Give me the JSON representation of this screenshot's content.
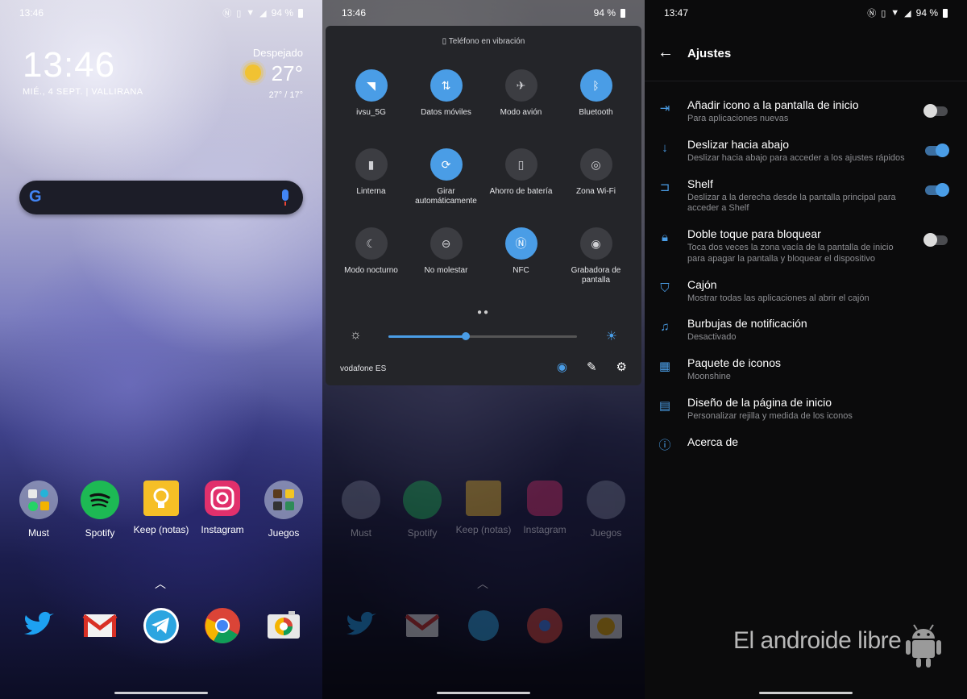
{
  "colors": {
    "accent": "#4a9de6",
    "panel": "#242529",
    "settings_bg": "#0b0b0c"
  },
  "home": {
    "status": {
      "time": "13:46",
      "battery": "94 %"
    },
    "clock": {
      "time": "13:46",
      "date": "MIÉ., 4 SEPT. | VALLIRANA"
    },
    "weather": {
      "condition": "Despejado",
      "temp": "27°",
      "range": "27° / 17°"
    },
    "apps": [
      {
        "label": "Must",
        "icon": "folder-icon"
      },
      {
        "label": "Spotify",
        "icon": "spotify-icon"
      },
      {
        "label": "Keep (notas)",
        "icon": "keep-icon"
      },
      {
        "label": "Instagram",
        "icon": "instagram-icon"
      },
      {
        "label": "Juegos",
        "icon": "folder-icon"
      }
    ],
    "dock": [
      "twitter-icon",
      "gmail-icon",
      "telegram-icon",
      "chrome-icon",
      "camera-icon"
    ]
  },
  "quick": {
    "status": {
      "time": "13:46",
      "battery": "94 %"
    },
    "vibration_label": "Teléfono en vibración",
    "tiles": [
      {
        "label": "ivsu_5G",
        "icon": "wifi-icon",
        "on": true
      },
      {
        "label": "Datos móviles",
        "icon": "mobile-data-icon",
        "on": true
      },
      {
        "label": "Modo avión",
        "icon": "airplane-icon",
        "on": false
      },
      {
        "label": "Bluetooth",
        "icon": "bluetooth-icon",
        "on": true
      },
      {
        "label": "Linterna",
        "icon": "flashlight-icon",
        "on": false
      },
      {
        "label": "Girar automáticamente",
        "icon": "auto-rotate-icon",
        "on": true
      },
      {
        "label": "Ahorro de batería",
        "icon": "battery-saver-icon",
        "on": false
      },
      {
        "label": "Zona Wi-Fi",
        "icon": "hotspot-icon",
        "on": false
      },
      {
        "label": "Modo nocturno",
        "icon": "night-mode-icon",
        "on": false
      },
      {
        "label": "No molestar",
        "icon": "dnd-icon",
        "on": false
      },
      {
        "label": "NFC",
        "icon": "nfc-icon",
        "on": true
      },
      {
        "label": "Grabadora de pantalla",
        "icon": "screen-recorder-icon",
        "on": false
      }
    ],
    "brightness": 0.41,
    "carrier": "vodafone ES"
  },
  "settings": {
    "status": {
      "time": "13:47",
      "battery": "94 %"
    },
    "title": "Ajustes",
    "items": [
      {
        "name": "Añadir icono a la pantalla de inicio",
        "sub": "Para aplicaciones nuevas",
        "icon": "add-to-home-icon",
        "toggle": false
      },
      {
        "name": "Deslizar hacia abajo",
        "sub": "Deslizar hacia abajo para acceder a los ajustes rápidos",
        "icon": "swipe-down-icon",
        "toggle": true
      },
      {
        "name": "Shelf",
        "sub": "Deslizar a la derecha desde la pantalla principal para acceder a Shelf",
        "icon": "shelf-icon",
        "toggle": true
      },
      {
        "name": "Doble toque para bloquear",
        "sub": "Toca dos veces la zona vacía de la pantalla de inicio para apagar la pantalla y bloquear el dispositivo",
        "icon": "lock-icon",
        "toggle": false
      },
      {
        "name": "Cajón",
        "sub": "Mostrar todas las aplicaciones al abrir el cajón",
        "icon": "drawer-icon",
        "toggle": null
      },
      {
        "name": "Burbujas de notificación",
        "sub": "Desactivado",
        "icon": "bell-icon",
        "toggle": null
      },
      {
        "name": "Paquete de iconos",
        "sub": "Moonshine",
        "icon": "grid-icon",
        "toggle": null
      },
      {
        "name": "Diseño de la página de inicio",
        "sub": "Personalizar rejilla y medida de los iconos",
        "icon": "layout-icon",
        "toggle": null
      },
      {
        "name": "Acerca de",
        "sub": "",
        "icon": "info-icon",
        "toggle": null
      }
    ],
    "watermark": "El androide libre"
  }
}
